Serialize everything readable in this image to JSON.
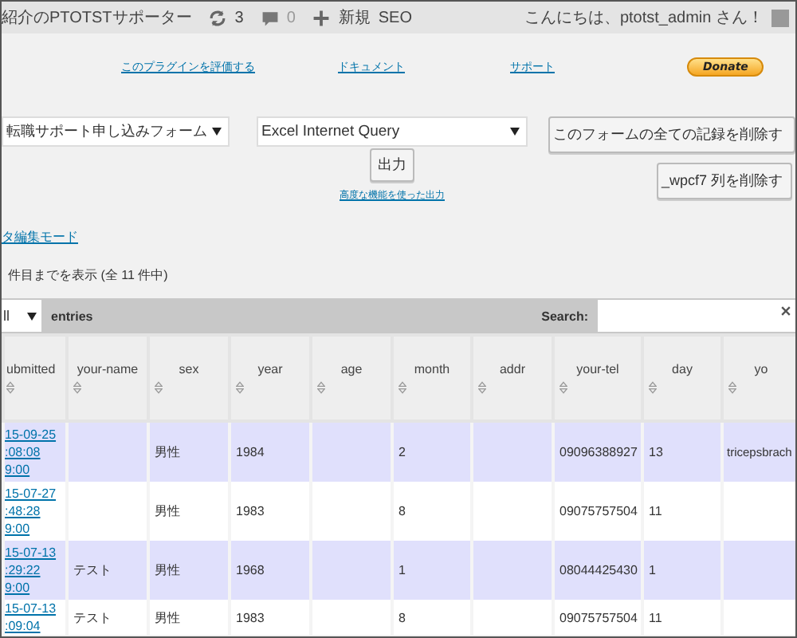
{
  "admin_bar": {
    "site_title": "紹介のPTOTSTサポーター",
    "updates_count": "3",
    "comments_count": "0",
    "new_label": "新規",
    "seo_label": "SEO",
    "greeting": "こんにちは、ptotst_admin さん！"
  },
  "plugin_links": [
    "このプラグインを評価する",
    "ドキュメント",
    "サポート"
  ],
  "donate_button": "Donate",
  "form_select": {
    "value": "転職サポート申し込みフォーム"
  },
  "format_select": {
    "value": "Excel Internet Query"
  },
  "export_button": "出力",
  "advanced_export_link": "高度な機能を使った出力",
  "delete_all_button": "このフォームの全ての記録を削除す",
  "delete_column_button": "_wpcf7 列を削除す",
  "edit_mode_link": "タ編集モード",
  "showing_text": "件目までを表示 (全 11 件中)",
  "table_controls": {
    "length_select": "ll",
    "entries_label": "entries",
    "search_label": "Search:"
  },
  "table": {
    "columns": [
      "ubmitted",
      "your-name",
      "sex",
      "year",
      "age",
      "month",
      "addr",
      "your-tel",
      "day",
      "yo"
    ],
    "rows": [
      {
        "cells": [
          [
            "15-09-25",
            ":08:08",
            "9:00"
          ],
          "",
          "男性",
          "1984",
          "",
          "2",
          "",
          "09096388927",
          "13",
          "tricepsbrach"
        ]
      },
      {
        "cells": [
          [
            "15-07-27",
            ":48:28",
            "9:00"
          ],
          "",
          "男性",
          "1983",
          "",
          "8",
          "",
          "09075757504",
          "11",
          ""
        ]
      },
      {
        "cells": [
          [
            "15-07-13",
            ":29:22",
            "9:00"
          ],
          "テスト",
          "男性",
          "1968",
          "",
          "1",
          "",
          "08044425430",
          "1",
          ""
        ]
      },
      {
        "cells": [
          [
            "15-07-13",
            ":09:04"
          ],
          "テスト",
          "男性",
          "1983",
          "",
          "8",
          "",
          "09075757504",
          "11",
          ""
        ]
      }
    ]
  }
}
